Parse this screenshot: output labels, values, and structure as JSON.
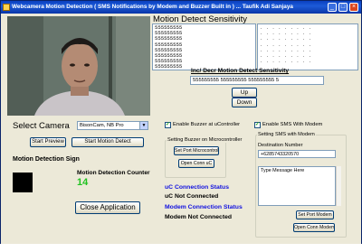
{
  "window": {
    "title": "Webcamera Motion Detection ( SMS Notifications by Modem and Buzzer Built in ) ... Taufik Adi Sanjaya",
    "minimize_icon": "minimize-icon",
    "maximize_icon": "maximize-icon",
    "close_icon": "close-icon",
    "title_bar_color": "#0a3fc0"
  },
  "motion": {
    "sensitivity_title": "Motion Detect Sensitivity",
    "sensitivity_rows": "555555555\n555555555\n555555555\n555555555\n555555555\n555555555\n555555555\n555555555",
    "dotted_rows": ". . . . . . . . .\n. . . . . . . . .\n. . . . . . . . .\n. . . . . . . . .\n. . . . . . . . .\n. . . . . . . . .\n. . . . . . . . .",
    "incdec_title": "Inc/ Decr Motion Detect Sensitivity",
    "incdec_value": "555555555 555555555 555555555 5",
    "up_label": "Up",
    "down_label": "Down"
  },
  "camera": {
    "select_label": "Select Camera",
    "selected": "BisonCam, NB Pro",
    "start_preview": "Start Preview",
    "start_motion": "Start Motion Detect"
  },
  "detection": {
    "sign_label": "Motion Detection Sign",
    "counter_label": "Motion Detection Counter",
    "counter_value": "14",
    "counter_color": "#1fc21f",
    "close_app": "Close Application"
  },
  "buzzer": {
    "enable_label": "Enable Buzzer at uController",
    "enabled": true,
    "group_title": "Setting Buzzer on Microcontroller",
    "set_port": "Set Port Microcontroller",
    "open_conn": "Open Conn uC",
    "status_title": "uC Connection Status",
    "status_value": "uC Not Connected"
  },
  "modem": {
    "enable_label": "Enable SMS With Modem",
    "enabled": true,
    "group_title": "Setting SMS with Modem",
    "dest_label": "Destination Number",
    "dest_value": "+6285743320570",
    "message_placeholder": "Type Message Here",
    "status_title": "Modem Connection Status",
    "status_value": "Modem Not Connected",
    "set_port": "Set Port Modem",
    "open_conn": "Open Conn Modem",
    "status_color": "#1010e0"
  }
}
